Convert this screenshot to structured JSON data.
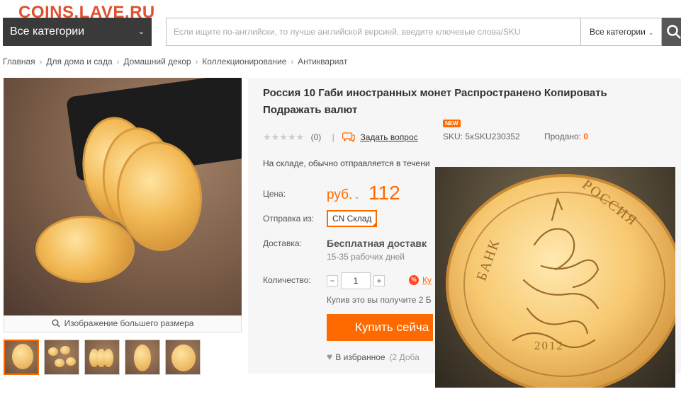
{
  "watermark": "COINS.LAVE.RU",
  "header": {
    "categories_button": "Все категории",
    "search_placeholder": "Если ищите по-английски, то лучше английской версией, введите ключевые слова/SKU",
    "search_category": "Все категории"
  },
  "breadcrumbs": [
    "Главная",
    "Для дома и сада",
    "Домашний декор",
    "Коллекционирование",
    "Антиквариат"
  ],
  "gallery": {
    "caption": "Изображение большего размера",
    "thumbnail_count": 5
  },
  "product": {
    "title": "Россия 10 Габи иностранных монет Распространено Копировать Подражать валют",
    "rating_count": "(0)",
    "rating_divider": "|",
    "ask_question": "Задать вопрос",
    "new_badge": "NEW",
    "sku": "SKU: 5xSKU230352",
    "sold_label": "Продано:",
    "sold_value": "0",
    "stock_text": "На складе, обычно отправляется в течени",
    "price_label": "Цена:",
    "currency": "руб.",
    "price": "112",
    "ship_from_label": "Отправка из:",
    "ship_from_value": "CN Склад",
    "delivery_label": "Доставка:",
    "delivery_value": "Бесплатная доставк",
    "delivery_days": "15-35 рабочих дней",
    "quantity_label": "Количество:",
    "quantity": "1",
    "promo_icon": "%",
    "promo_link": "Ку",
    "buy_note": "Купив это вы получите 2 Б",
    "buy_button": "Купить сейча",
    "wishlist": "В избранное",
    "wishlist_count": "(2 Доба"
  },
  "colors": {
    "accent": "#ff6a00",
    "dark_bar": "#3a3a3a",
    "watermark": "#e05030"
  }
}
